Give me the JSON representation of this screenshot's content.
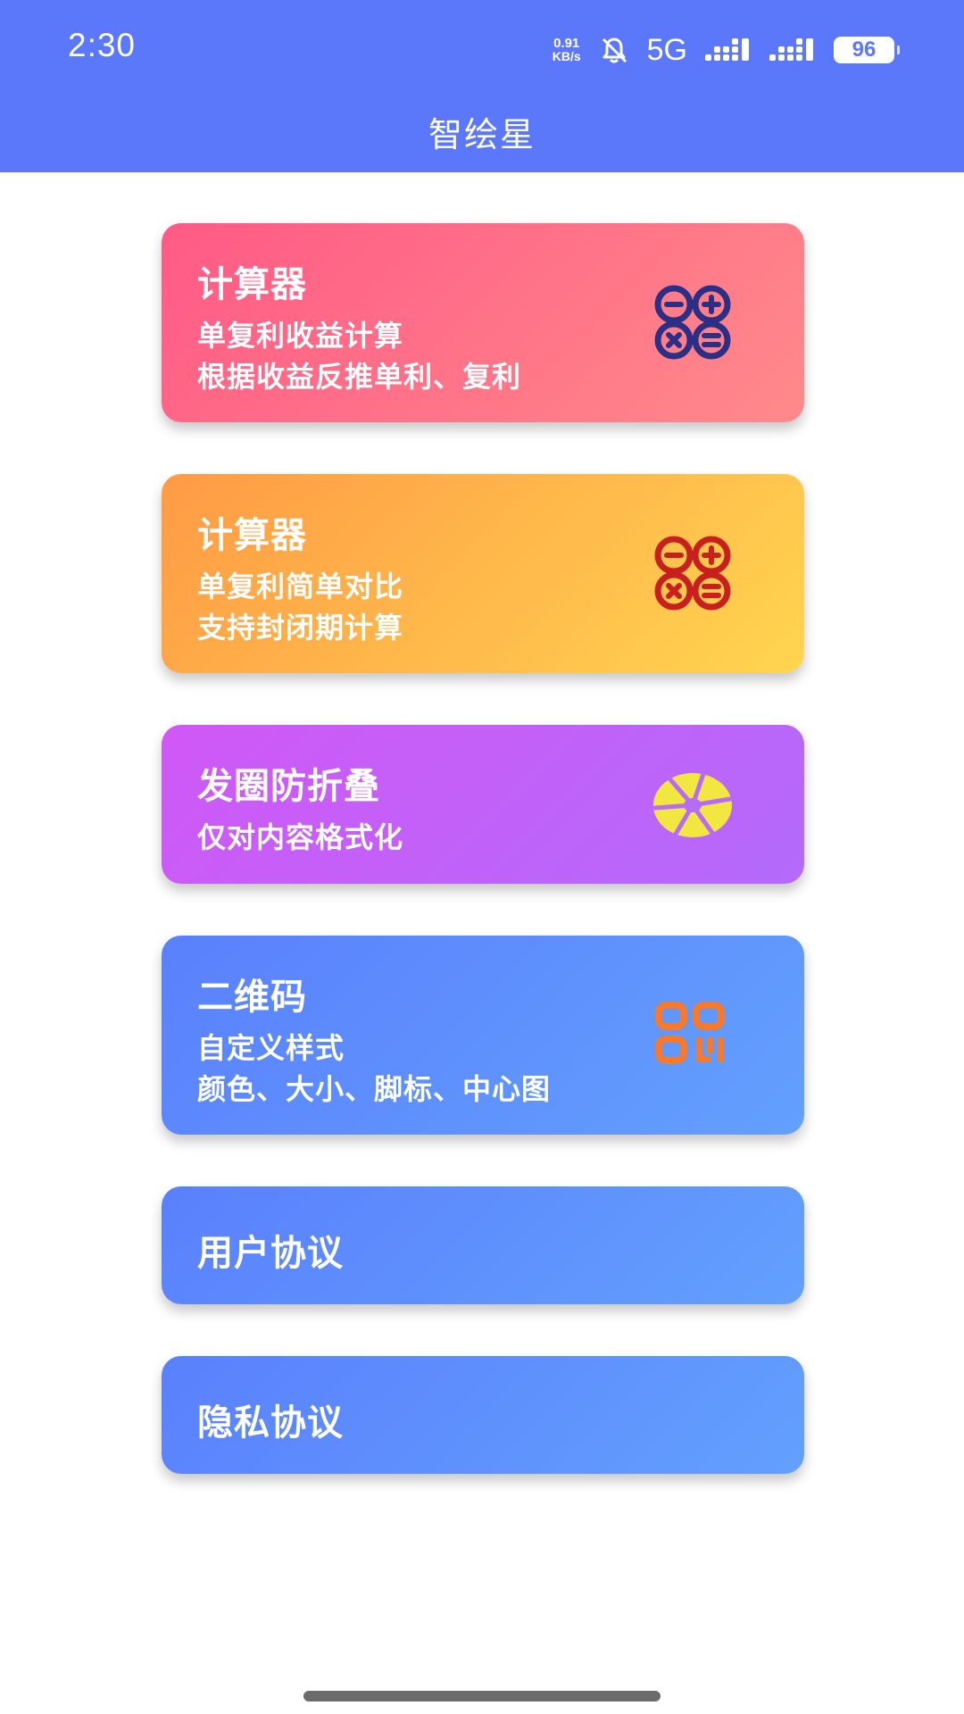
{
  "status_bar": {
    "time": "2:30",
    "net_speed_value": "0.91",
    "net_speed_unit": "KB/s",
    "network_type": "5G",
    "battery": "96"
  },
  "header": {
    "title": "智绘星"
  },
  "cards": [
    {
      "title": "计算器",
      "lines": [
        "单复利收益计算",
        "根据收益反推单利、复利"
      ],
      "icon": "calculator-icon",
      "icon_color": "#2b2f86"
    },
    {
      "title": "计算器",
      "lines": [
        "单复利简单对比",
        "支持封闭期计算"
      ],
      "icon": "calculator-icon",
      "icon_color": "#c81f1f"
    },
    {
      "title": "发圈防折叠",
      "lines": [
        "仅对内容格式化"
      ],
      "icon": "aperture-icon",
      "icon_color": "#f2e640"
    },
    {
      "title": "二维码",
      "lines": [
        "自定义样式",
        "颜色、大小、脚标、中心图"
      ],
      "icon": "qr-code-icon",
      "icon_color": "#f37a2e"
    },
    {
      "title": "用户协议",
      "lines": []
    },
    {
      "title": "隐私协议",
      "lines": []
    }
  ],
  "colors": {
    "header_bg": "#5b78fb",
    "card_calc_1": [
      "#ff5a86",
      "#ff8a8a"
    ],
    "card_calc_2": [
      "#ff9a45",
      "#ffd550"
    ],
    "card_share": [
      "#d058f6",
      "#b36afb"
    ],
    "card_blue": [
      "#5a80fd",
      "#63a0fd"
    ]
  }
}
